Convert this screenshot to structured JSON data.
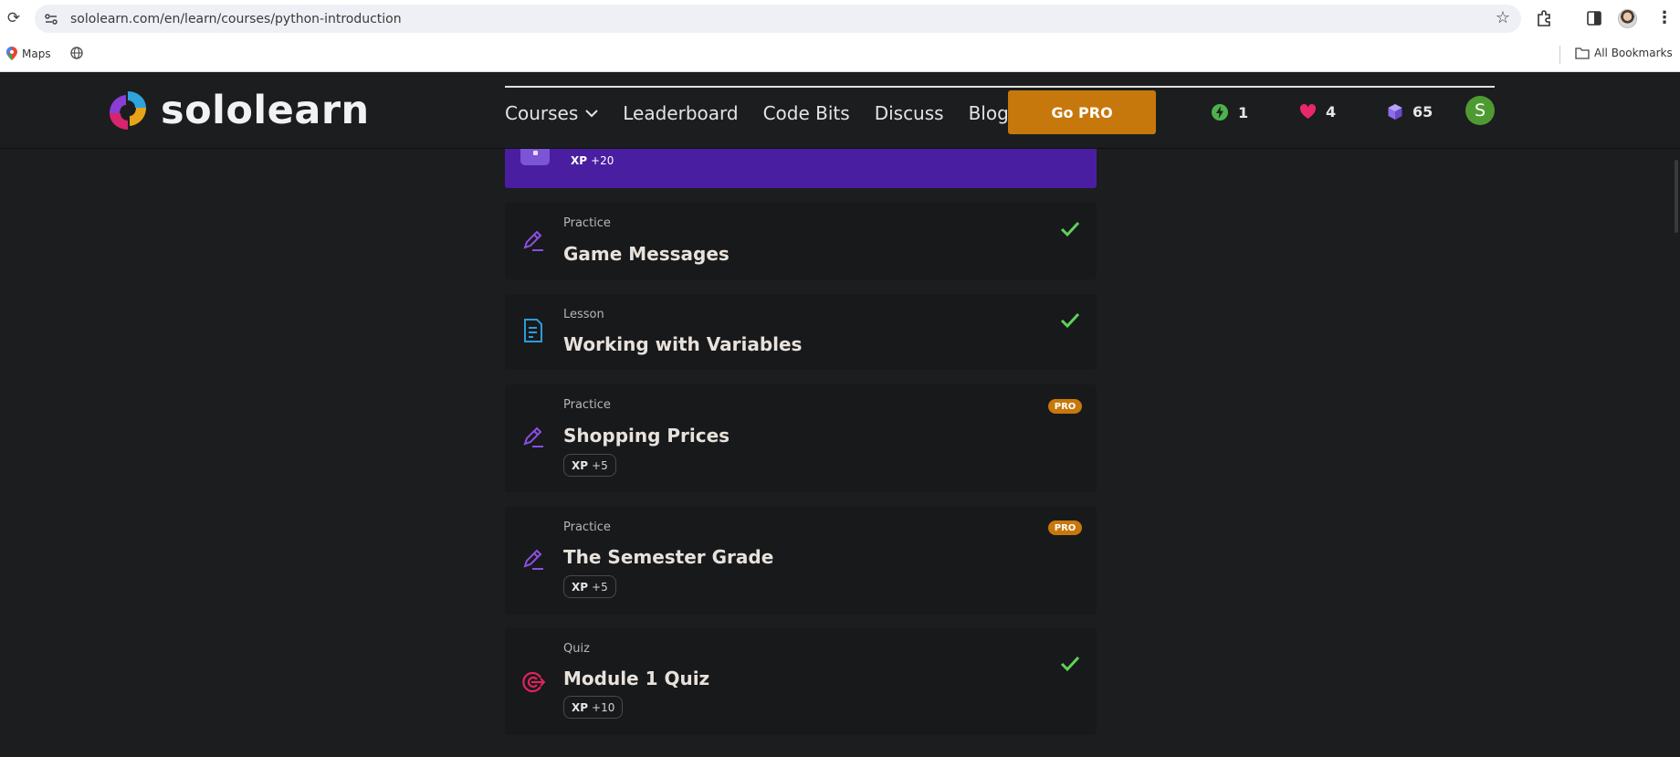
{
  "browser": {
    "url": "sololearn.com/en/learn/courses/python-introduction",
    "bookmarks": [
      {
        "label": "Maps",
        "icon": "maps-pin-icon"
      },
      {
        "label": "",
        "icon": "globe-icon"
      }
    ],
    "all_bookmarks_label": "All Bookmarks"
  },
  "header": {
    "logo_text": "sololearn",
    "nav": [
      {
        "label": "Courses",
        "has_dropdown": true
      },
      {
        "label": "Leaderboard"
      },
      {
        "label": "Code Bits"
      },
      {
        "label": "Discuss"
      },
      {
        "label": "Blog"
      }
    ],
    "go_pro_label": "Go PRO",
    "stats": {
      "streak": "1",
      "hearts": "4",
      "bits": "65"
    },
    "avatar_letter": "S",
    "colors": {
      "accent": "#c7780c",
      "avatar": "#4e9a32",
      "heart": "#e8286a",
      "streak": "#4bb34a",
      "bits": "#8e6ee8"
    }
  },
  "purple_card": {
    "xp_label": "XP",
    "xp_value": "+20",
    "color": "#4a1ea1"
  },
  "cards": [
    {
      "type": "Practice",
      "title": "Game Messages",
      "icon": "pencil-practice-icon",
      "completed": true,
      "pro": false,
      "xp_label": "",
      "xp_value": ""
    },
    {
      "type": "Lesson",
      "title": "Working with Variables",
      "icon": "lesson-document-icon",
      "completed": true,
      "pro": false,
      "xp_label": "",
      "xp_value": ""
    },
    {
      "type": "Practice",
      "title": "Shopping Prices",
      "icon": "pencil-practice-icon",
      "completed": false,
      "pro": true,
      "pro_label": "PRO",
      "xp_label": "XP",
      "xp_value": "+5"
    },
    {
      "type": "Practice",
      "title": "The Semester Grade",
      "icon": "pencil-practice-icon",
      "completed": false,
      "pro": true,
      "pro_label": "PRO",
      "xp_label": "XP",
      "xp_value": "+5"
    },
    {
      "type": "Quiz",
      "title": "Module 1 Quiz",
      "icon": "quiz-target-icon",
      "completed": true,
      "pro": false,
      "xp_label": "XP",
      "xp_value": "+10"
    }
  ]
}
